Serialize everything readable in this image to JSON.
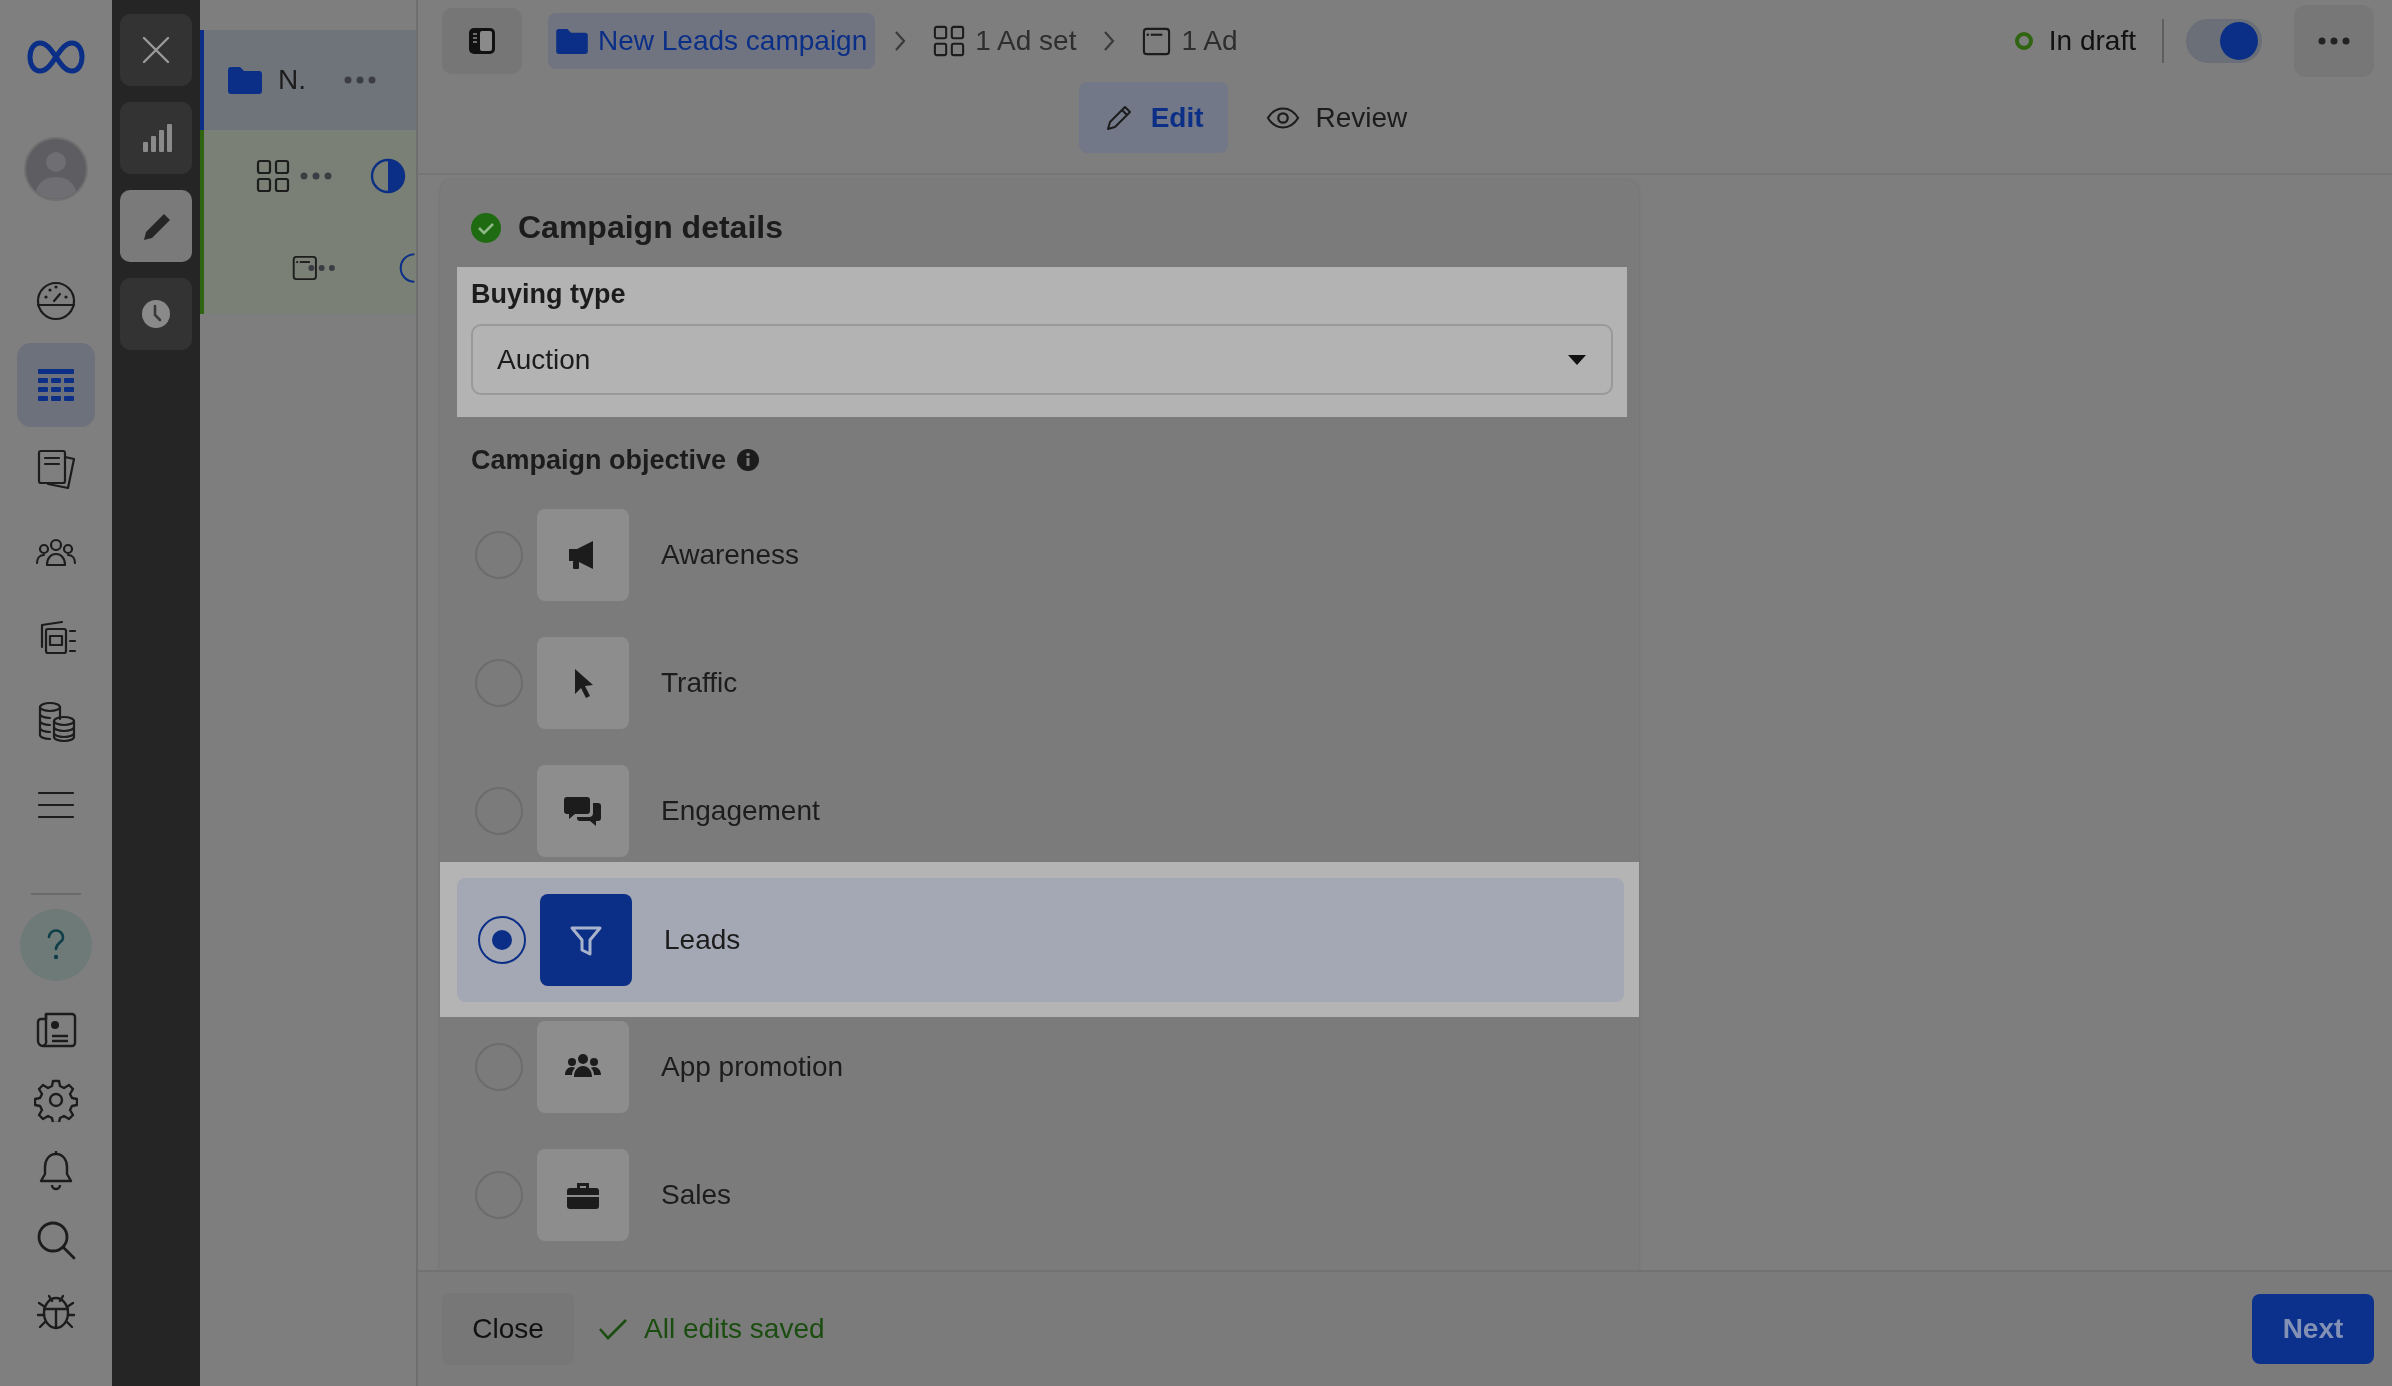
{
  "nav": {
    "items": [
      {
        "selected": false
      },
      {
        "selected": true
      },
      {
        "selected": false
      },
      {
        "selected": false
      },
      {
        "selected": false
      },
      {
        "selected": false
      },
      {
        "selected": false
      }
    ]
  },
  "tools": [
    {
      "selected": false
    },
    {
      "selected": false
    },
    {
      "selected": true
    },
    {
      "selected": false
    }
  ],
  "tree": {
    "label": "N.",
    "selected": true,
    "children": [
      {
        "selected": false,
        "children": [
          {
            "selected": false
          }
        ]
      }
    ]
  },
  "breadcrumb": [
    {
      "label": "New Leads campaign",
      "selected": true
    },
    {
      "label": "1 Ad set",
      "selected": false
    },
    {
      "label": "1 Ad",
      "selected": false
    }
  ],
  "status": {
    "label": "In draft",
    "on": true
  },
  "tabs": [
    {
      "label": "Edit",
      "selected": true
    },
    {
      "label": "Review",
      "selected": false
    }
  ],
  "card": {
    "title": "Campaign details",
    "complete": true,
    "buying_type": {
      "label": "Buying type",
      "value": "Auction",
      "highlighted": true
    },
    "objective": {
      "label": "Campaign objective",
      "options": [
        {
          "label": "Awareness",
          "selected": false
        },
        {
          "label": "Traffic",
          "selected": false
        },
        {
          "label": "Engagement",
          "selected": false
        },
        {
          "label": "Leads",
          "selected": true
        },
        {
          "label": "App promotion",
          "selected": false
        },
        {
          "label": "Sales",
          "selected": false
        }
      ]
    }
  },
  "footer": {
    "close": "Close",
    "saved": "All edits saved",
    "next": "Next"
  }
}
